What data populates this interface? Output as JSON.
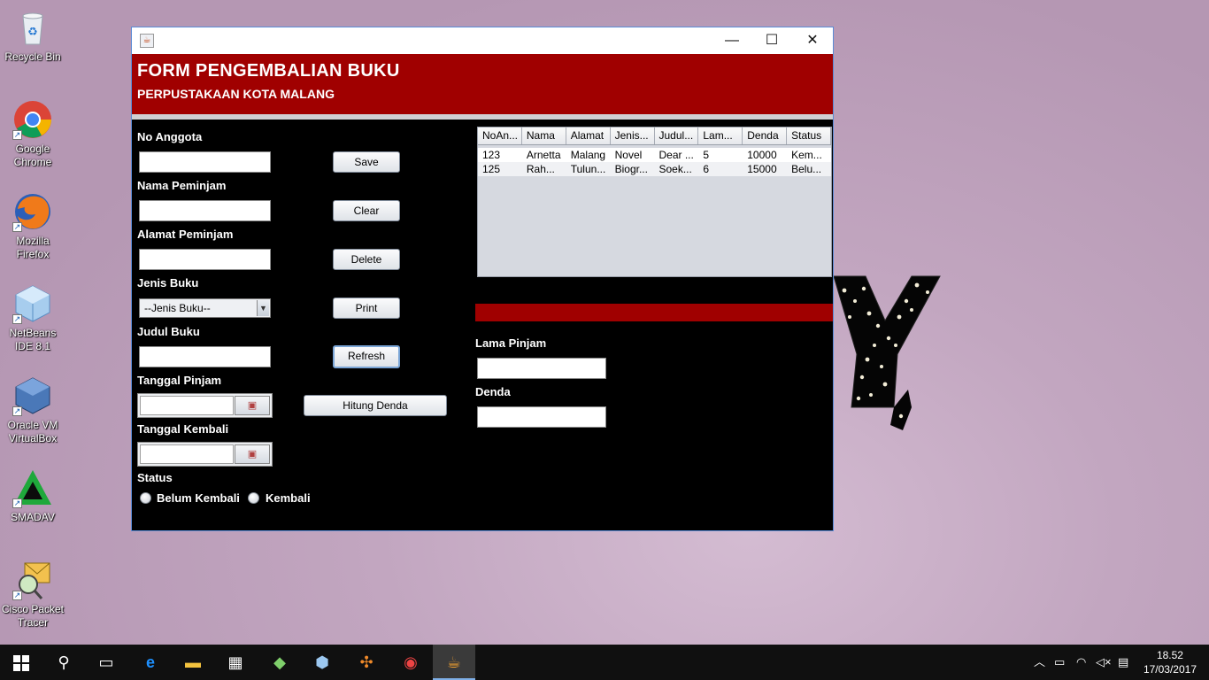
{
  "desktop": {
    "icons": [
      {
        "label": "Recycle Bin",
        "icon": "recycle-bin-icon"
      },
      {
        "label": "Google Chrome",
        "icon": "chrome-icon"
      },
      {
        "label": "Mozilla Firefox",
        "icon": "firefox-icon"
      },
      {
        "label": "NetBeans IDE 8.1",
        "icon": "netbeans-icon"
      },
      {
        "label": "Oracle VM VirtualBox",
        "icon": "virtualbox-icon"
      },
      {
        "label": "SMADAV",
        "icon": "smadav-icon"
      },
      {
        "label": "Cisco Packet Tracer",
        "icon": "packet-tracer-icon"
      }
    ]
  },
  "window": {
    "title": "",
    "minimize": "—",
    "maximize": "☐",
    "close": "✕"
  },
  "banner": {
    "title": "FORM PENGEMBALIAN BUKU",
    "subtitle": "PERPUSTAKAAN KOTA MALANG"
  },
  "form": {
    "no_anggota": {
      "label": "No Anggota",
      "value": ""
    },
    "nama_peminjam": {
      "label": "Nama Peminjam",
      "value": ""
    },
    "alamat_peminjam": {
      "label": "Alamat Peminjam",
      "value": ""
    },
    "jenis_buku": {
      "label": "Jenis Buku",
      "selected": "--Jenis Buku--"
    },
    "judul_buku": {
      "label": "Judul Buku",
      "value": ""
    },
    "tanggal_pinjam": {
      "label": "Tanggal Pinjam",
      "value": ""
    },
    "tanggal_kembali": {
      "label": "Tanggal Kembali",
      "value": ""
    },
    "status": {
      "label": "Status",
      "options": [
        "Belum Kembali",
        "Kembali"
      ]
    },
    "lama_pinjam": {
      "label": "Lama Pinjam",
      "value": ""
    },
    "denda": {
      "label": "Denda",
      "value": ""
    }
  },
  "buttons": {
    "save": "Save",
    "clear": "Clear",
    "delete": "Delete",
    "print": "Print",
    "refresh": "Refresh",
    "hitung_denda": "Hitung Denda"
  },
  "table": {
    "columns": [
      "NoAn...",
      "Nama",
      "Alamat",
      "Jenis...",
      "Judul...",
      "Lam...",
      "Denda",
      "Status"
    ],
    "rows": [
      [
        "123",
        "Arnetta",
        "Malang",
        "Novel",
        "Dear ...",
        "5",
        "10000",
        "Kem..."
      ],
      [
        "125",
        "Rah...",
        "Tulun...",
        "Biogr...",
        "Soek...",
        "6",
        "15000",
        "Belu..."
      ]
    ]
  },
  "taskbar": {
    "clock_time": "18.52",
    "clock_date": "17/03/2017"
  },
  "colors": {
    "accent_red": "#a00000",
    "panel_bg": "#000000",
    "desktop_bg": "#c2a6c0"
  }
}
